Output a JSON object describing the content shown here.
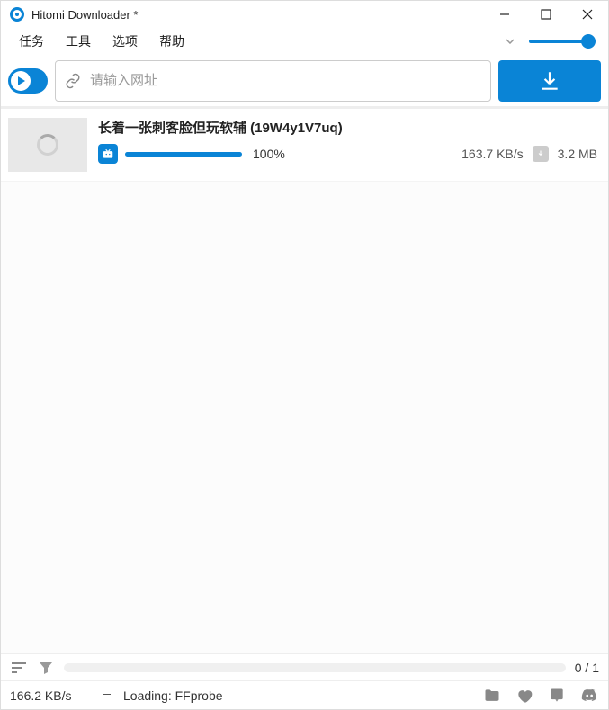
{
  "window": {
    "title": "Hitomi Downloader *"
  },
  "menu": {
    "tasks": "任务",
    "tools": "工具",
    "options": "选项",
    "help": "帮助"
  },
  "toolbar": {
    "url_placeholder": "请输入网址",
    "url_value": ""
  },
  "tasks": [
    {
      "title": "长着一张刺客脸但玩软辅 (19W4y1V7uq)",
      "progress_pct": "100%",
      "speed": "163.7 KB/s",
      "size": "3.2 MB",
      "site": "bilibili"
    }
  ],
  "footer": {
    "counter": "0 / 1",
    "speed": "166.2 KB/s",
    "status": "Loading: FFprobe"
  },
  "colors": {
    "accent": "#0a84d6"
  }
}
